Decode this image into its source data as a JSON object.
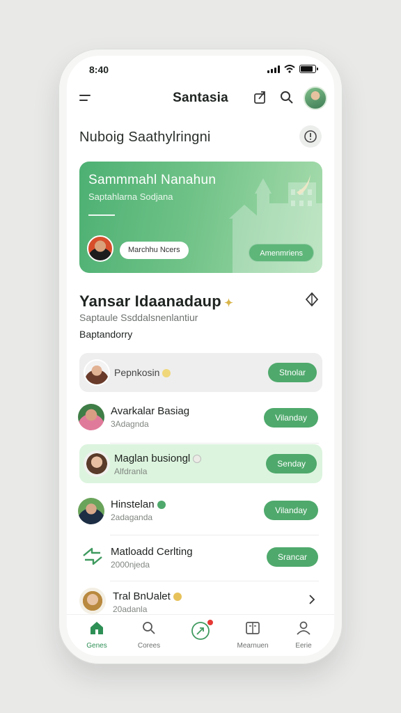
{
  "status": {
    "time": "8:40"
  },
  "header": {
    "title": "Santasia"
  },
  "subtitle": "Nuboig Saathylringni",
  "hero": {
    "title": "Sammmahl Nanahun",
    "subtitle": "Saptahlarna Sodjana",
    "pill_label": "Marchhu Ncers",
    "button_label": "Amenmriens"
  },
  "section": {
    "title": "Yansar Idaanadaup",
    "subtitle": "Saptaule Ssddalsnenlantiur",
    "category": "Baptandorry"
  },
  "list": [
    {
      "name": "Pepnkosin",
      "sub": "",
      "button": "Stnolar"
    },
    {
      "name": "Avarkalar Basiag",
      "sub": "3Adagnda",
      "button": "Vilanday"
    },
    {
      "name": "Maglan busiongl",
      "sub": "Alfdranla",
      "button": "Senday"
    },
    {
      "name": "Hinstelan",
      "sub": "2adaganda",
      "button": "Vilanday"
    },
    {
      "name": "Matloadd Cerlting",
      "sub": "2000njeda",
      "button": "Srancar"
    },
    {
      "name": "Tral BnUalet",
      "sub": "20adanla",
      "button": ""
    }
  ],
  "tabs": [
    {
      "label": "Genes",
      "icon": "home-icon"
    },
    {
      "label": "Corees",
      "icon": "search-icon"
    },
    {
      "label": "",
      "icon": "compass-icon",
      "badge": true
    },
    {
      "label": "Mearnuen",
      "icon": "book-icon"
    },
    {
      "label": "Eerie",
      "icon": "profile-icon"
    }
  ],
  "colors": {
    "accent": "#4fa96c",
    "accent_dark": "#2e8f55",
    "highlight_green": "#dcf4de",
    "badge_red": "#e53935"
  }
}
